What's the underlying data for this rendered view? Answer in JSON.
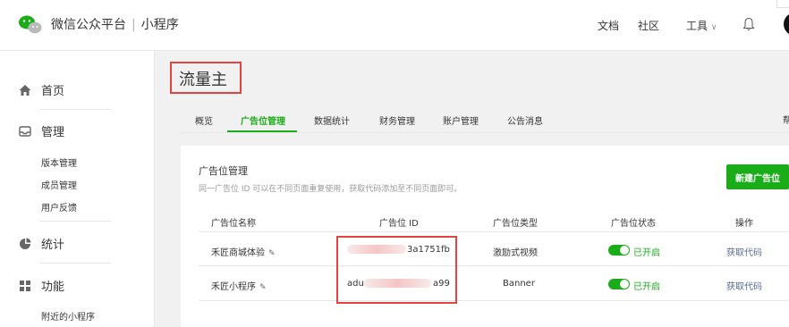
{
  "header": {
    "brand_name": "微信公众平台",
    "separator": "|",
    "product": "小程序",
    "nav": [
      "文档",
      "社区",
      "工具"
    ],
    "tools_caret": "∨"
  },
  "sidebar": {
    "home": "首页",
    "manage": "管理",
    "manage_items": [
      "版本管理",
      "成员管理",
      "用户反馈"
    ],
    "stats": "统计",
    "features": "功能",
    "feature_items": [
      "附近的小程序"
    ]
  },
  "page": {
    "title": "流量主"
  },
  "tabs": {
    "items": [
      "概览",
      "广告位管理",
      "数据统计",
      "财务管理",
      "账户管理",
      "公告消息"
    ],
    "active_index": 1,
    "right_fragment": "帮"
  },
  "panel": {
    "title": "广告位管理",
    "description": "同一广告位 ID 可以在不同页面重复使用，获取代码添加至不同页面即可。",
    "new_button": "新建广告位"
  },
  "table": {
    "columns": [
      "广告位名称",
      "广告位 ID",
      "广告位类型",
      "广告位状态",
      "操作"
    ],
    "rows": [
      {
        "name": "禾匠商城体验",
        "id": "3a1751fb",
        "type": "激励式视频",
        "status": "已开启",
        "action": "获取代码"
      },
      {
        "name": "禾匠小程序",
        "id_prefix": "adu",
        "id_suffix": "a99",
        "type": "Banner",
        "status": "已开启",
        "action": "获取代码"
      }
    ]
  },
  "colors": {
    "accent": "#1aad19",
    "highlight": "#e64340",
    "link": "#576b95"
  }
}
